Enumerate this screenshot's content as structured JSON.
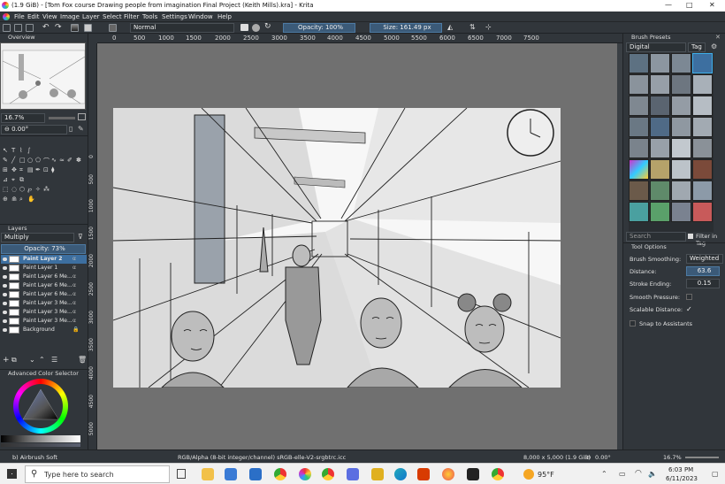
{
  "window": {
    "title": "(1.9 GiB) - [Tom Fox course Drawing people from imagination Final Project (Keith Mills).kra] - Krita",
    "controls": [
      "—",
      "□",
      "✕"
    ]
  },
  "menu": [
    "File",
    "Edit",
    "View",
    "Image",
    "Layer",
    "Select",
    "Filter",
    "Tools",
    "Settings",
    "Window",
    "Help"
  ],
  "toolbar": {
    "blend_mode": "Normal",
    "opacity": "Opacity: 100%",
    "size": "Size: 161.49 px"
  },
  "ruler": {
    "h_ticks": [
      "0",
      "500",
      "1000",
      "1500",
      "2000",
      "2500",
      "3000",
      "3500",
      "4000",
      "4500",
      "5000",
      "5500",
      "6000",
      "6500",
      "7000",
      "7500"
    ],
    "v_ticks": [
      "0",
      "500",
      "1000",
      "1500",
      "2000",
      "2500",
      "3000",
      "3500",
      "4000",
      "4500",
      "5000"
    ]
  },
  "overview": {
    "header": "Overview",
    "zoom": "16.7%",
    "rotation": "0.00°"
  },
  "layers": {
    "header": "Layers",
    "blend_mode": "Multiply",
    "opacity": "Opacity: 73%",
    "items": [
      {
        "name": "Paint Layer 2",
        "selected": true
      },
      {
        "name": "Paint Layer 1",
        "selected": false
      },
      {
        "name": "Paint Layer 6 Me...",
        "selected": false
      },
      {
        "name": "Paint Layer 6 Me...",
        "selected": false
      },
      {
        "name": "Paint Layer 6 Me...",
        "selected": false
      },
      {
        "name": "Paint Layer 3 Me...",
        "selected": false
      },
      {
        "name": "Paint Layer 3 Me...",
        "selected": false
      },
      {
        "name": "Paint Layer 3 Me...",
        "selected": false
      },
      {
        "name": "Background",
        "selected": false
      }
    ]
  },
  "color_selector": {
    "header": "Advanced Color Selector"
  },
  "brush_presets": {
    "header": "Brush Presets",
    "tag": "Digital",
    "tag_button": "Tag",
    "search_placeholder": "Search",
    "filter_label": "Filter in Tag"
  },
  "tool_options": {
    "header": "Tool Options",
    "brush_smoothing_label": "Brush Smoothing:",
    "brush_smoothing_value": "Weighted",
    "distance_label": "Distance:",
    "distance_value": "63.6",
    "stroke_ending_label": "Stroke Ending:",
    "stroke_ending_value": "0.15",
    "smooth_pressure_label": "Smooth Pressure:",
    "scalable_distance_label": "Scalable Distance:",
    "snap_label": "Snap to Assistants"
  },
  "status": {
    "brush": "b) Airbrush Soft",
    "color_model": "RGB/Alpha (8-bit integer/channel)  sRGB-elle-V2-srgbtrc.icc",
    "dimensions": "8,000 x 5,000 (1.9 GiB)",
    "rotation": "0.00°",
    "zoom": "16.7%"
  },
  "taskbar": {
    "search_placeholder": "Type here to search",
    "weather": "95°F",
    "time": "6:03 PM",
    "date": "6/11/2023"
  },
  "colors": {
    "ui_bg": "#31363b",
    "canvas_bg": "#707070",
    "selection": "#3d6fa0",
    "accent": "#3daee9"
  }
}
